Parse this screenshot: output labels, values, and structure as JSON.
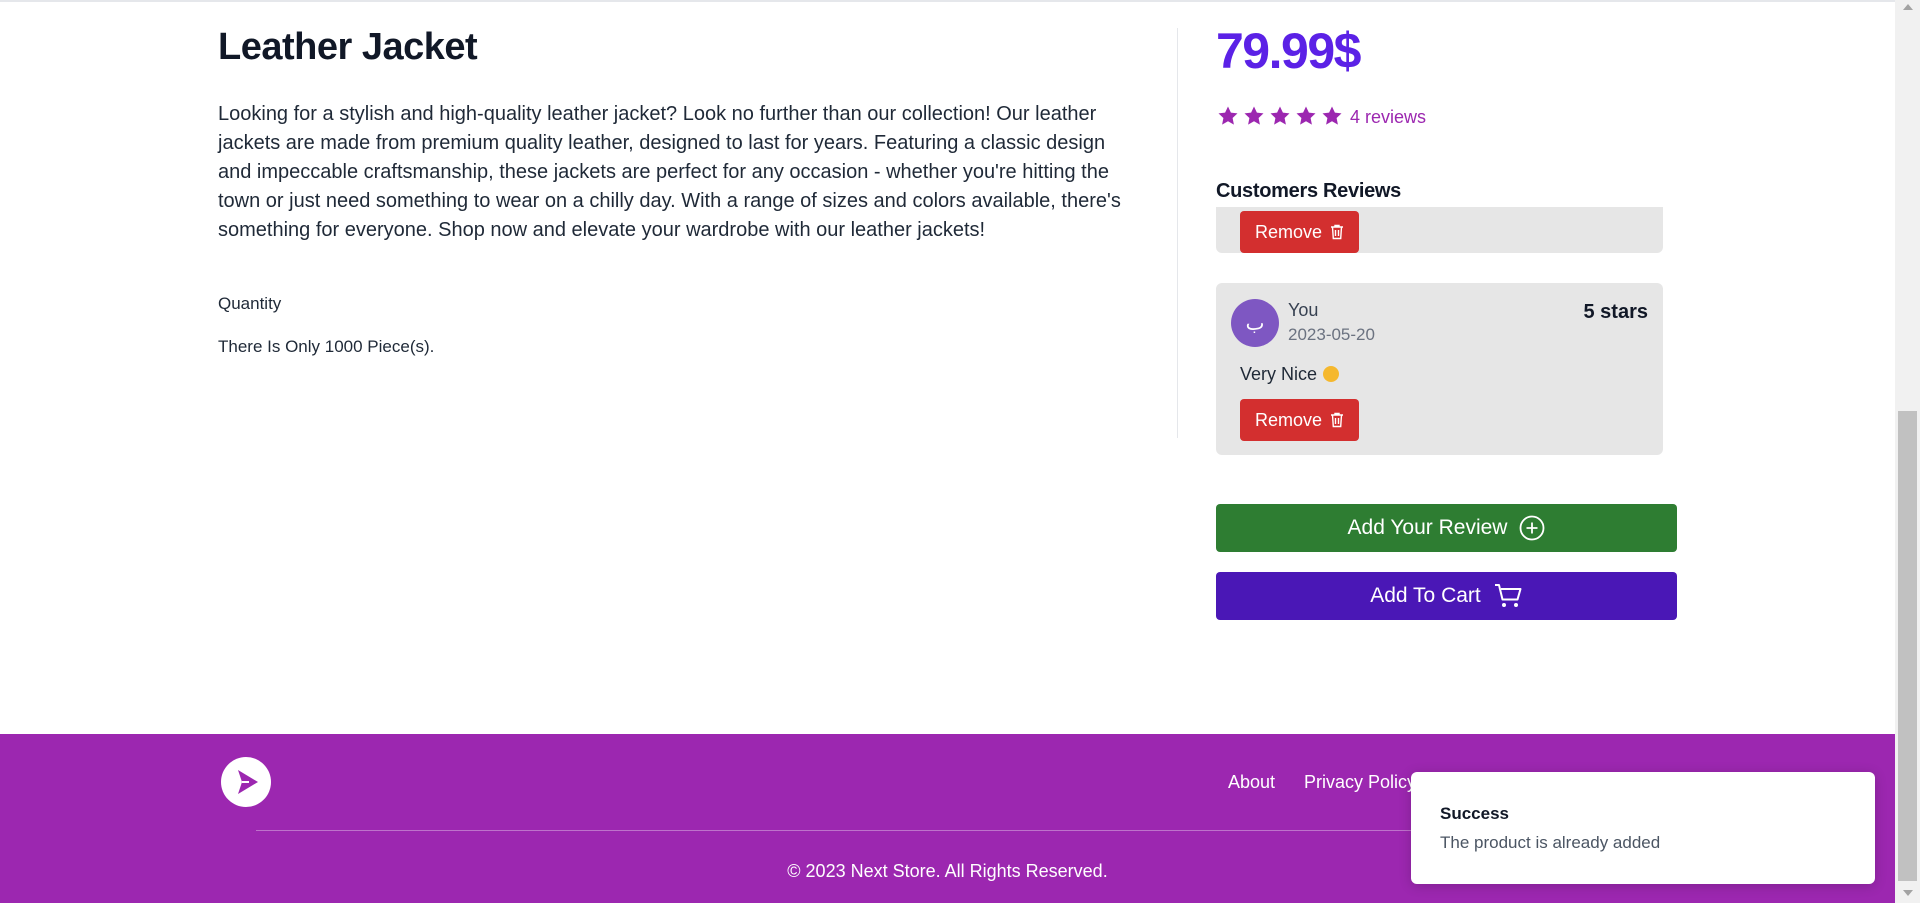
{
  "product": {
    "title": "Leather Jacket",
    "description": "Looking for a stylish and high-quality leather jacket? Look no further than our collection! Our leather jackets are made from premium quality leather, designed to last for years. Featuring a classic design and impeccable craftsmanship, these jackets are perfect for any occasion - whether you're hitting the town or just need something to wear on a chilly day. With a range of sizes and colors available, there's something for everyone. Shop now and elevate your wardrobe with our leather jackets!",
    "quantity_label": "Quantity",
    "stock_text": "There Is Only 1000 Piece(s).",
    "price": "79.99$",
    "rating": 5,
    "rating_max": 5,
    "reviews_count_text": "4 reviews"
  },
  "reviews": {
    "section_title": "Customers Reviews",
    "items": [
      {
        "remove_label": "Remove"
      },
      {
        "avatar_initial": "ب",
        "name": "You",
        "date": "2023-05-20",
        "rating_text": "5 stars",
        "text": "Very Nice",
        "remove_label": "Remove"
      }
    ]
  },
  "actions": {
    "add_review_label": "Add Your Review",
    "add_to_cart_label": "Add To Cart"
  },
  "footer": {
    "links": [
      "About",
      "Privacy Policy"
    ],
    "copyright": "© 2023 Next Store. All Rights Reserved."
  },
  "toast": {
    "title": "Success",
    "message": "The product is already added"
  },
  "colors": {
    "price": "#5b21e6",
    "stars": "#9c27b0",
    "remove_button": "#d32f2f",
    "add_review_button": "#2e7d32",
    "add_to_cart_button": "#4a17b6",
    "footer_background": "#9c27b0"
  },
  "icons": {
    "star": "star-icon",
    "trash": "trash-icon",
    "plus_circle": "plus-circle-icon",
    "cart": "cart-icon",
    "logo": "play-logo-icon"
  }
}
